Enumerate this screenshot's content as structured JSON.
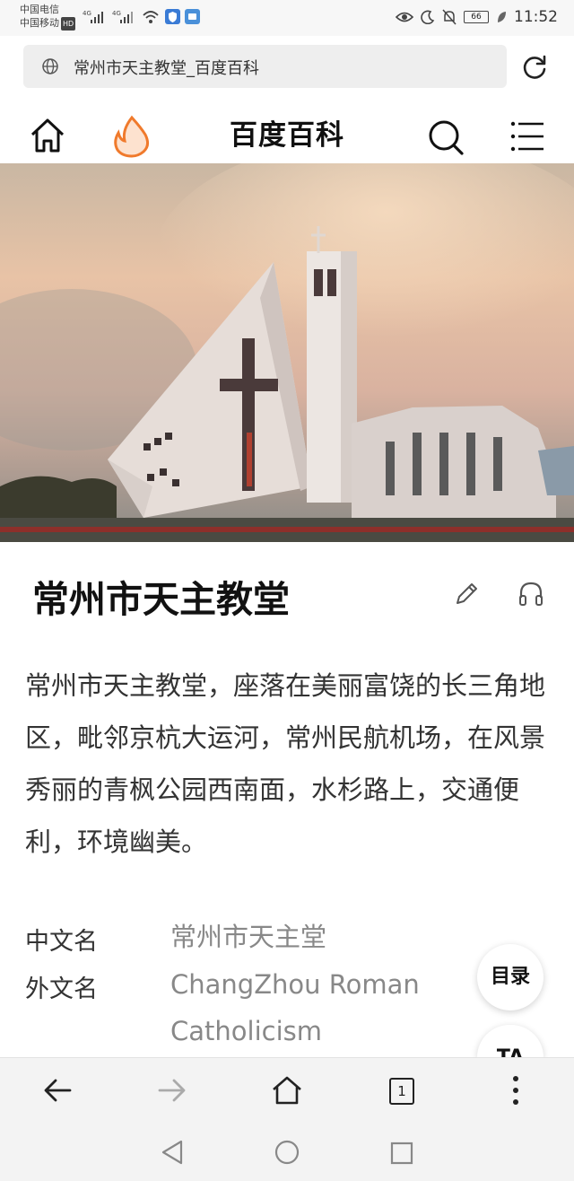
{
  "status": {
    "carrier1": "中国电信",
    "carrier2": "中国移动",
    "hd": "HD",
    "net1": "4G",
    "net2": "4G",
    "battery": "66",
    "time": "11:52"
  },
  "browser": {
    "url_title": "常州市天主教堂_百度百科"
  },
  "site": {
    "title": "百度百科"
  },
  "article": {
    "title": "常州市天主教堂",
    "summary": "常州市天主教堂，座落在美丽富饶的长三角地区，毗邻京杭大运河，常州民航机场，在风景秀丽的青枫公园西南面，水杉路上，交通便利，环境幽美。",
    "info": [
      {
        "label": "中文名",
        "value": "常州市天主堂"
      },
      {
        "label": "外文名",
        "value": "ChangZhou Roman Catholicism"
      }
    ]
  },
  "fab": {
    "toc": "目录",
    "ta": "TA"
  },
  "toolbar": {
    "tab_count": "1"
  }
}
